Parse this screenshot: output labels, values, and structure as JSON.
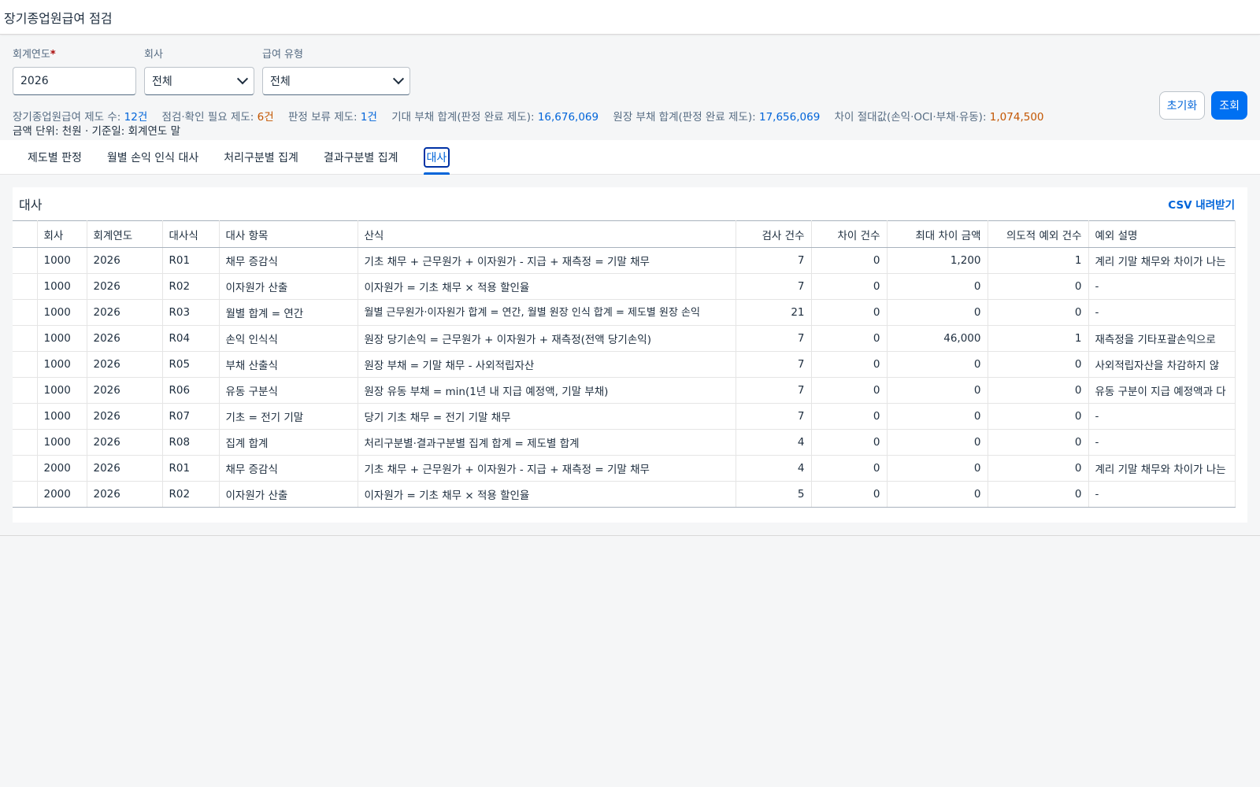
{
  "header": {
    "title": "장기종업원급여 점검"
  },
  "filters": {
    "year_label": "회계연도",
    "year_required": "*",
    "year_value": "2026",
    "company_label": "회사",
    "company_value": "전체",
    "type_label": "급여 유형",
    "type_value": "전체"
  },
  "buttons": {
    "reset": "초기화",
    "search": "조회"
  },
  "summary": {
    "plans_label": "장기종업원급여 제도 수:",
    "plans_value": "12건",
    "check_label": "점검·확인 필요 제도:",
    "check_value": "6건",
    "hold_label": "판정 보류 제도:",
    "hold_value": "1건",
    "expected_label": "기대 부채 합계(판정 완료 제도):",
    "expected_value": "16,676,069",
    "ledger_label": "원장 부채 합계(판정 완료 제도):",
    "ledger_value": "17,656,069",
    "diff_label": "차이 절대값(손익·OCI·부채·유동):",
    "diff_value": "1,074,500",
    "unit_line": "금액 단위: 천원 · 기준일: 회계연도 말"
  },
  "tabs": [
    "제도별 판정",
    "월별 손익 인식 대사",
    "처리구분별 집계",
    "결과구분별 집계",
    "대사"
  ],
  "panel": {
    "title": "대사",
    "csv": "CSV 내려받기"
  },
  "table": {
    "columns": [
      "",
      "회사",
      "회계연도",
      "대사식",
      "대사 항목",
      "산식",
      "검사 건수",
      "차이 건수",
      "최대 차이 금액",
      "의도적 예외 건수",
      "예외 설명"
    ],
    "rows": [
      [
        "",
        "1000",
        "2026",
        "R01",
        "채무 증감식",
        "기초 채무 + 근무원가 + 이자원가 - 지급 + 재측정 = 기말 채무",
        "7",
        "0",
        "1,200",
        "1",
        "계리 기말 채무와 차이가 나는"
      ],
      [
        "",
        "1000",
        "2026",
        "R02",
        "이자원가 산출",
        "이자원가 = 기초 채무 × 적용 할인율",
        "7",
        "0",
        "0",
        "0",
        "-"
      ],
      [
        "",
        "1000",
        "2026",
        "R03",
        "월별 합계 = 연간",
        "월별 근무원가·이자원가 합계 = 연간, 월별 원장 인식 합계 = 제도별 원장 손익",
        "21",
        "0",
        "0",
        "0",
        "-"
      ],
      [
        "",
        "1000",
        "2026",
        "R04",
        "손익 인식식",
        "원장 당기손익 = 근무원가 + 이자원가 + 재측정(전액 당기손익)",
        "7",
        "0",
        "46,000",
        "1",
        "재측정을 기타포괄손익으로"
      ],
      [
        "",
        "1000",
        "2026",
        "R05",
        "부채 산출식",
        "원장 부채 = 기말 채무 - 사외적립자산",
        "7",
        "0",
        "0",
        "0",
        "사외적립자산을 차감하지 않"
      ],
      [
        "",
        "1000",
        "2026",
        "R06",
        "유동 구분식",
        "원장 유동 부채 = min(1년 내 지급 예정액, 기말 부채)",
        "7",
        "0",
        "0",
        "0",
        "유동 구분이 지급 예정액과 다"
      ],
      [
        "",
        "1000",
        "2026",
        "R07",
        "기초 = 전기 기말",
        "당기 기초 채무 = 전기 기말 채무",
        "7",
        "0",
        "0",
        "0",
        "-"
      ],
      [
        "",
        "1000",
        "2026",
        "R08",
        "집계 합계",
        "처리구분별·결과구분별 집계 합계 = 제도별 합계",
        "4",
        "0",
        "0",
        "0",
        "-"
      ],
      [
        "",
        "2000",
        "2026",
        "R01",
        "채무 증감식",
        "기초 채무 + 근무원가 + 이자원가 - 지급 + 재측정 = 기말 채무",
        "4",
        "0",
        "0",
        "0",
        "계리 기말 채무와 차이가 나는"
      ],
      [
        "",
        "2000",
        "2026",
        "R02",
        "이자원가 산출",
        "이자원가 = 기초 채무 × 적용 할인율",
        "5",
        "0",
        "0",
        "0",
        "-"
      ]
    ]
  }
}
